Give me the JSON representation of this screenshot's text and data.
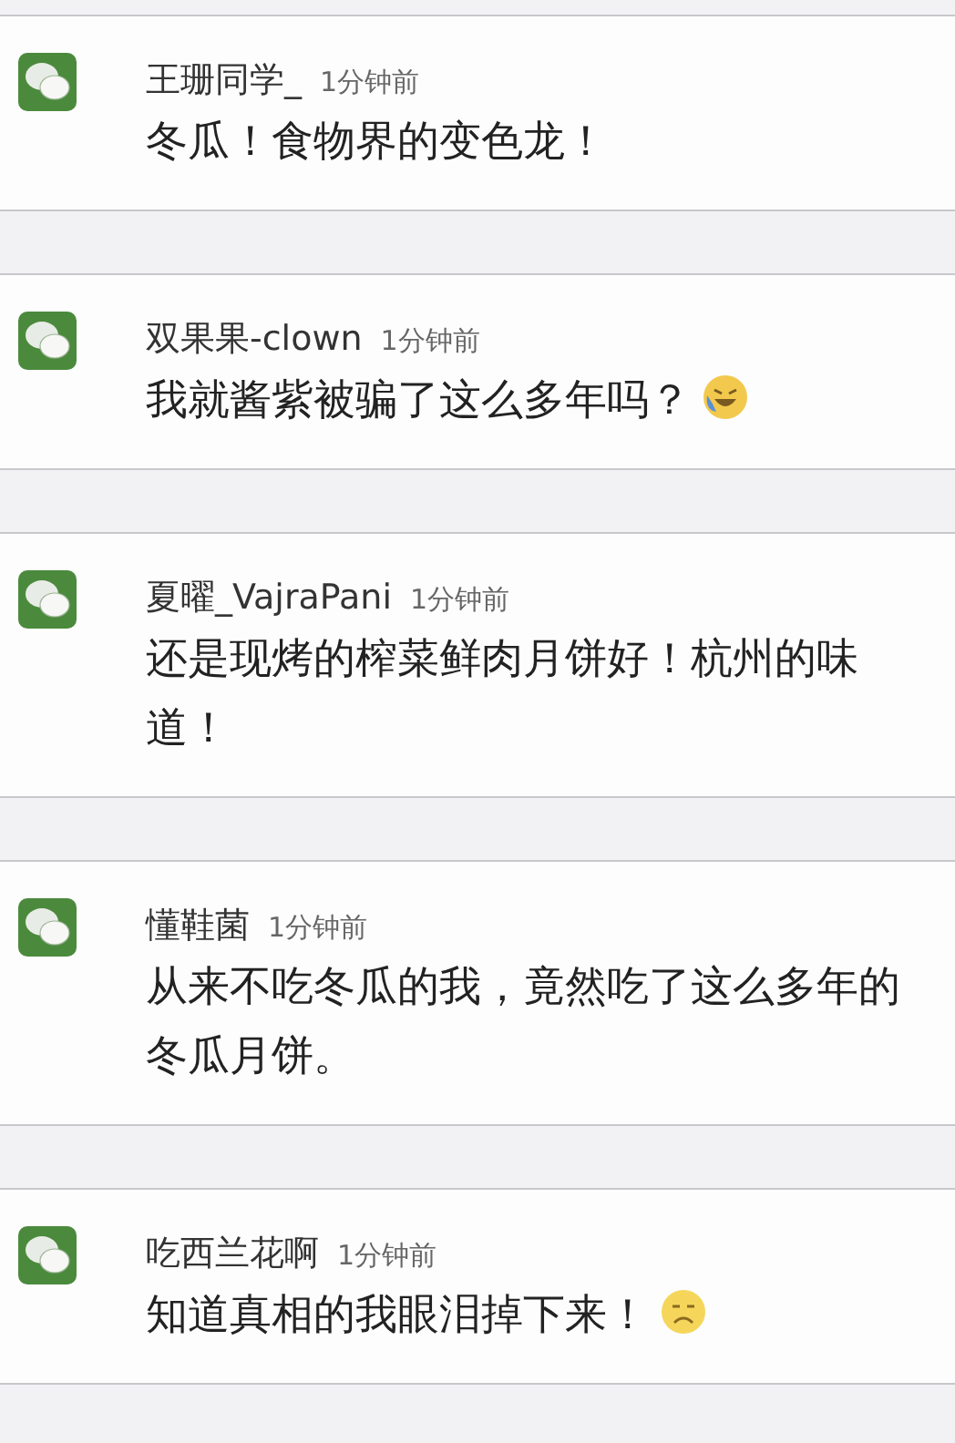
{
  "comments": [
    {
      "kind": "plain",
      "name": "王珊同学_",
      "time": "1分钟前",
      "text": "冬瓜！食物界的变色龙！"
    },
    {
      "kind": "tears",
      "name": "双果果-clown",
      "time": "1分钟前",
      "text": "我就酱紫被骗了这么多年吗？"
    },
    {
      "kind": "plain",
      "name": "夏曜_VajraPani",
      "time": "1分钟前",
      "text": "还是现烤的榨菜鲜肉月饼好！杭州的味道！"
    },
    {
      "kind": "plain",
      "name": "懂鞋菌",
      "time": "1分钟前",
      "text": "从来不吃冬瓜的我，竟然吃了这么多年的冬瓜月饼。"
    },
    {
      "kind": "sad",
      "name": "吃西兰花啊",
      "time": "1分钟前",
      "text": "知道真相的我眼泪掉下来！"
    }
  ]
}
